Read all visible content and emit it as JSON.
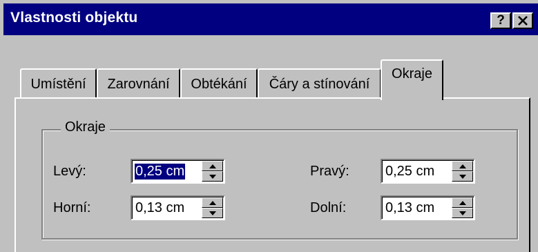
{
  "window": {
    "title": "Vlastnosti objektu",
    "help_label": "?",
    "titlebar_color": "#000080",
    "face_color": "#c0c0c0"
  },
  "tabs": [
    {
      "label": "Umístění",
      "active": false
    },
    {
      "label": "Zarovnání",
      "active": false
    },
    {
      "label": "Obtékání",
      "active": false
    },
    {
      "label": "Čáry a stínování",
      "active": false
    },
    {
      "label": "Okraje",
      "active": true
    }
  ],
  "margins": {
    "group_label": "Okraje",
    "left": {
      "label": "Levý:",
      "value": "0,25 cm"
    },
    "right": {
      "label": "Pravý:",
      "value": "0,25 cm"
    },
    "top": {
      "label": "Horní:",
      "value": "0,13 cm"
    },
    "bottom": {
      "label": "Dolní:",
      "value": "0,13 cm"
    }
  }
}
